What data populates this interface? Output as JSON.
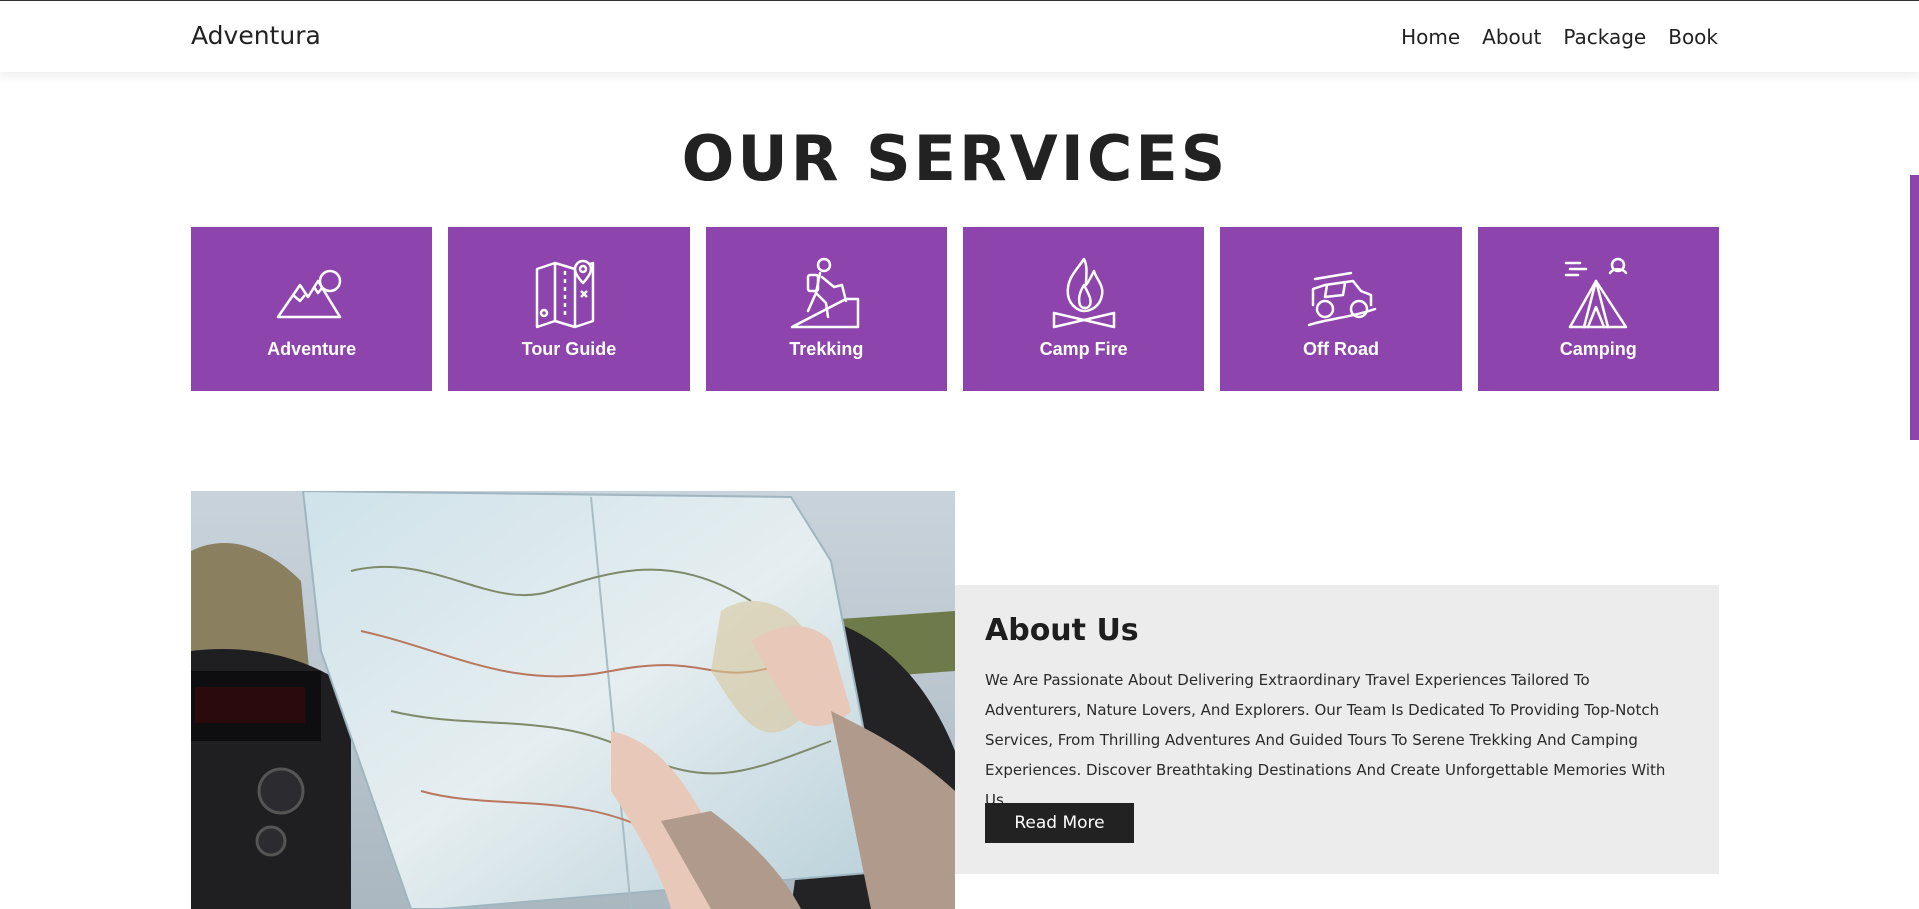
{
  "header": {
    "logo": "Adventura",
    "nav": [
      "Home",
      "About",
      "Package",
      "Book"
    ]
  },
  "services": {
    "title": "OUR SERVICES",
    "items": [
      {
        "label": "Adventure",
        "icon": "mountain-icon"
      },
      {
        "label": "Tour Guide",
        "icon": "map-icon"
      },
      {
        "label": "Trekking",
        "icon": "hiker-icon"
      },
      {
        "label": "Camp Fire",
        "icon": "campfire-icon"
      },
      {
        "label": "Off Road",
        "icon": "jeep-icon"
      },
      {
        "label": "Camping",
        "icon": "tent-icon"
      }
    ],
    "card_color": "#8e44ad"
  },
  "about": {
    "title": "About Us",
    "text": "We Are Passionate About Delivering Extraordinary Travel Experiences Tailored To Adventurers, Nature Lovers, And Explorers. Our Team Is Dedicated To Providing Top-Notch Services, From Thrilling Adventures And Guided Tours To Serene Trekking And Camping Experiences. Discover Breathtaking Destinations And Create Unforgettable Memories With Us.",
    "button": "Read More",
    "image": "hands-holding-road-map-in-car"
  }
}
